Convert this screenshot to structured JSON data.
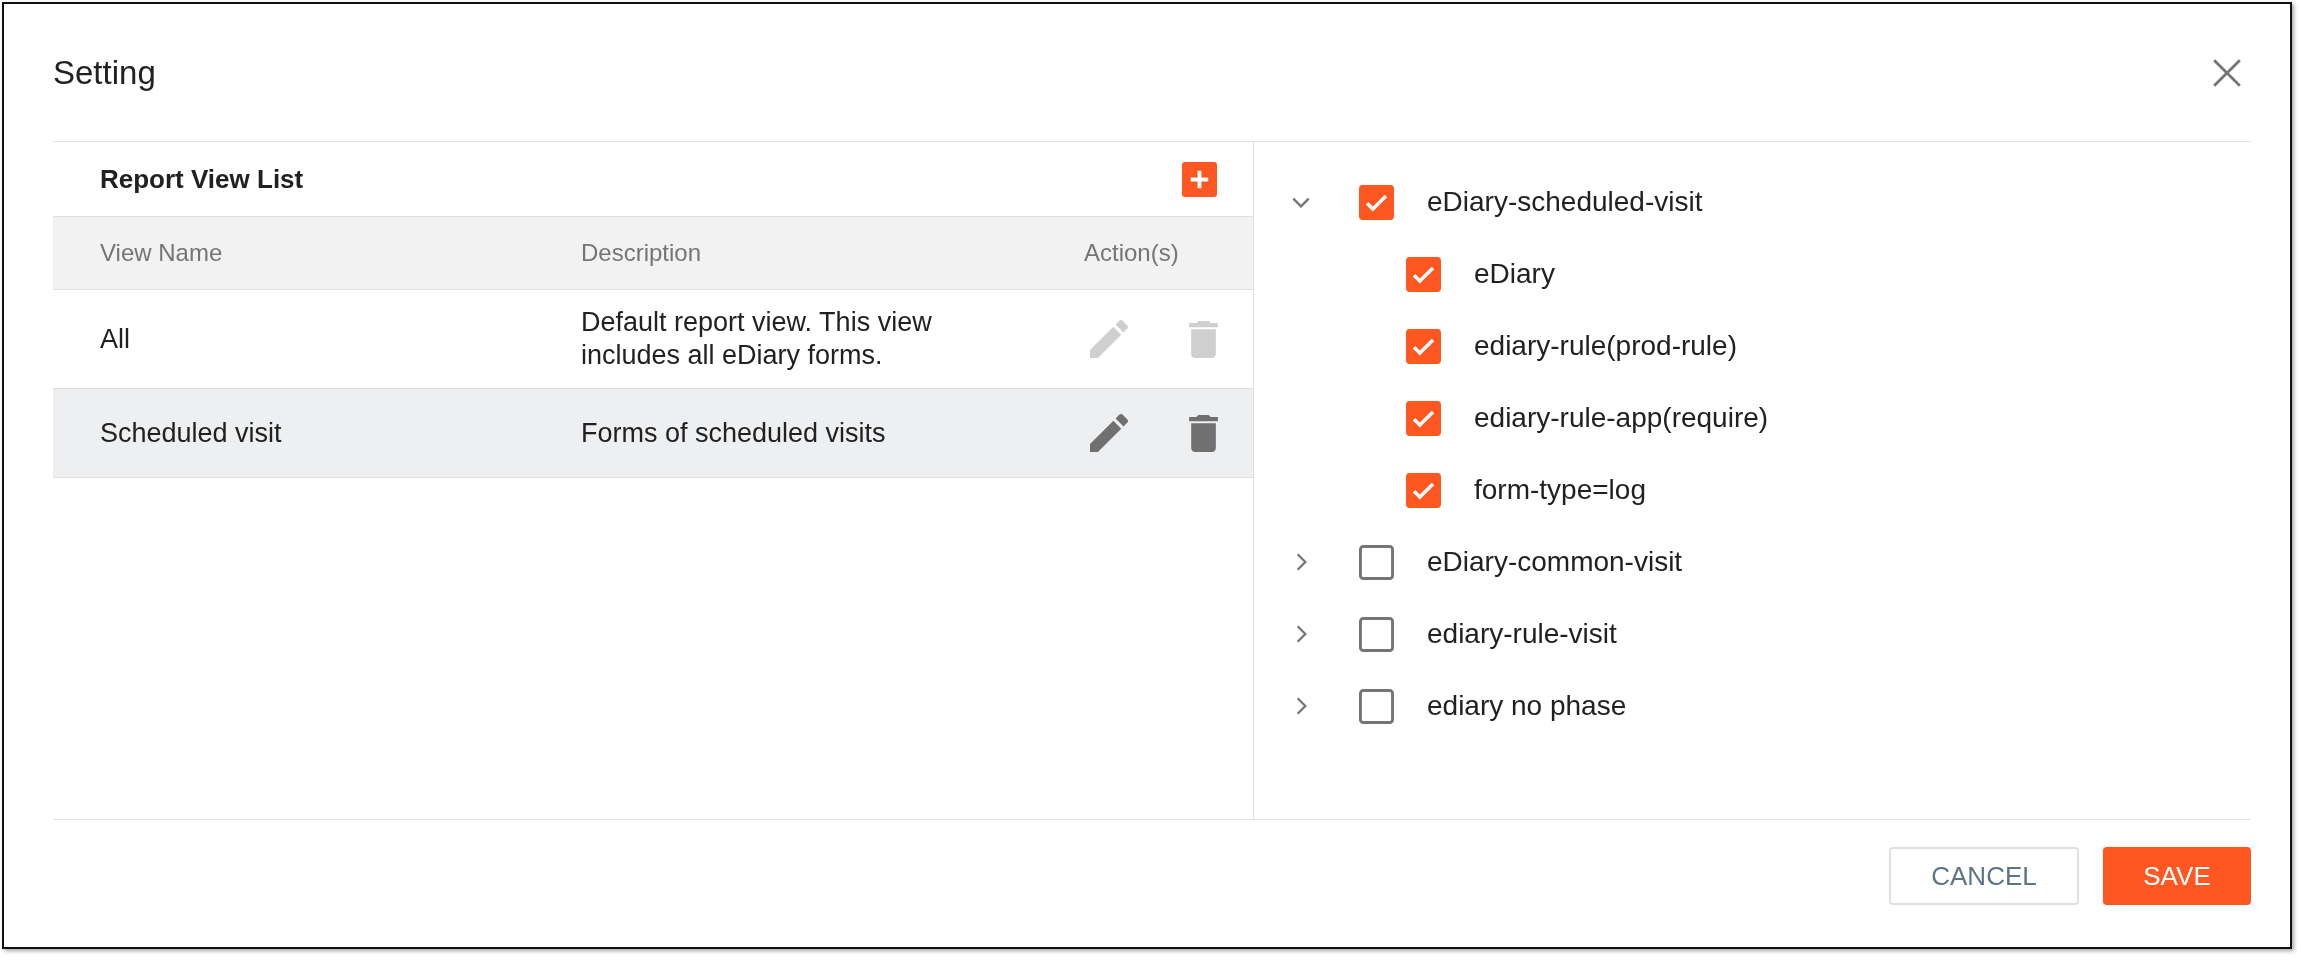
{
  "dialog": {
    "title": "Setting"
  },
  "report_list": {
    "title": "Report View List",
    "columns": [
      "View Name",
      "Description",
      "Action(s)"
    ],
    "rows": [
      {
        "view_name": "All",
        "description": "Default report view. This view includes all eDiary forms.",
        "selected": false,
        "actions_disabled": true
      },
      {
        "view_name": "Scheduled visit",
        "description": "Forms of scheduled visits",
        "selected": true,
        "actions_disabled": false
      }
    ]
  },
  "tree": [
    {
      "label": "eDiary-scheduled-visit",
      "checked": true,
      "expanded": true,
      "children": [
        {
          "label": "eDiary",
          "checked": true
        },
        {
          "label": "ediary-rule(prod-rule)",
          "checked": true
        },
        {
          "label": "ediary-rule-app(require)",
          "checked": true
        },
        {
          "label": "form-type=log",
          "checked": true
        }
      ]
    },
    {
      "label": "eDiary-common-visit",
      "checked": false,
      "expanded": false
    },
    {
      "label": "ediary-rule-visit",
      "checked": false,
      "expanded": false
    },
    {
      "label": "ediary no phase",
      "checked": false,
      "expanded": false
    }
  ],
  "buttons": [
    {
      "label": "CANCEL",
      "kind": "secondary"
    },
    {
      "label": "SAVE",
      "kind": "primary"
    }
  ]
}
